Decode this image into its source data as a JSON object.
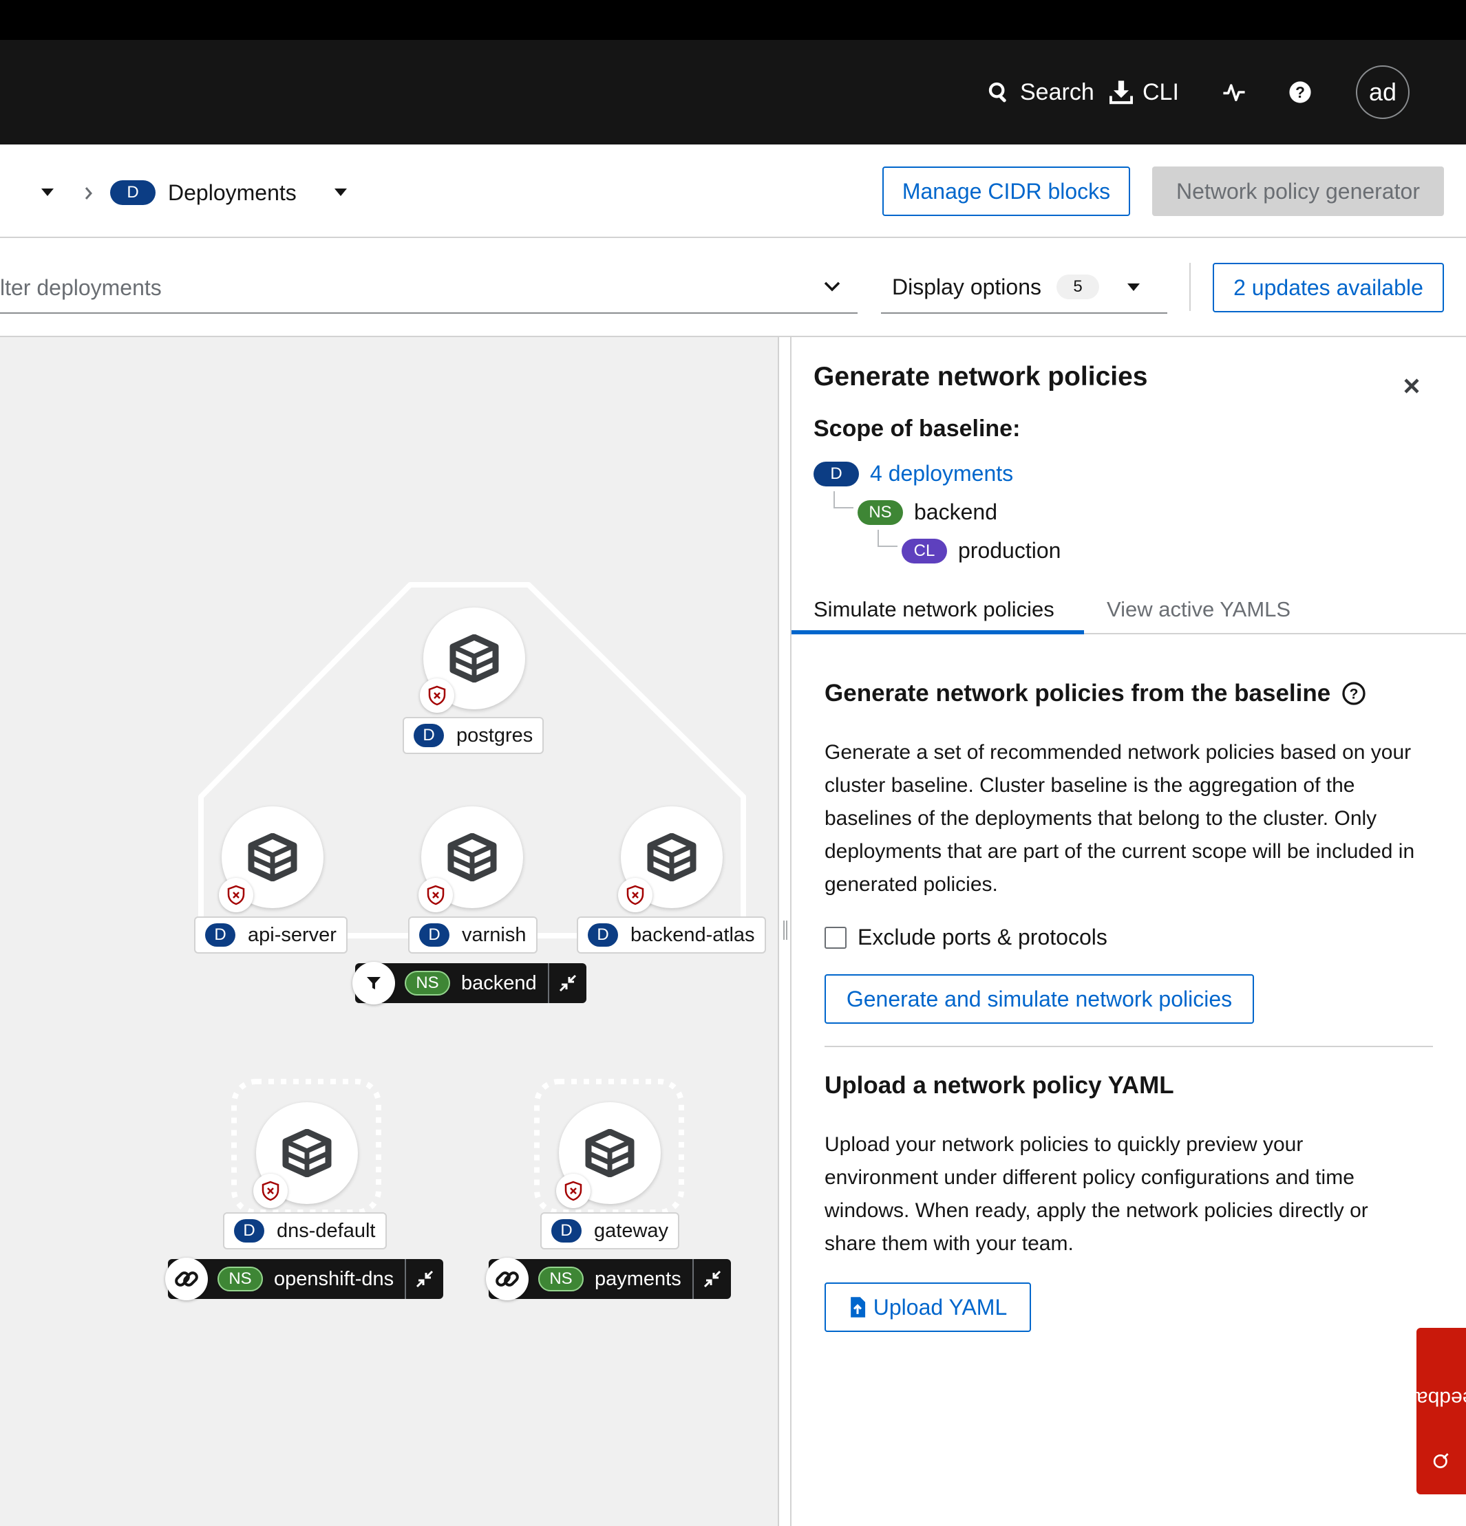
{
  "masthead": {
    "search_label": "Search",
    "cli_label": "CLI",
    "avatar_initials": "ad"
  },
  "toolbar": {
    "entity_badge": "D",
    "entity_label": "Deployments",
    "manage_cidr_label": "Manage CIDR blocks",
    "policy_generator_label": "Network policy generator"
  },
  "filter": {
    "placeholder_visible": "lter deployments",
    "display_options_label": "Display options",
    "display_options_count": "5",
    "updates_label": "2 updates available"
  },
  "graph": {
    "nodes": [
      {
        "badge": "D",
        "name": "postgres"
      },
      {
        "badge": "D",
        "name": "api-server"
      },
      {
        "badge": "D",
        "name": "varnish"
      },
      {
        "badge": "D",
        "name": "backend-atlas"
      },
      {
        "badge": "D",
        "name": "dns-default"
      },
      {
        "badge": "D",
        "name": "gateway"
      }
    ],
    "groups": [
      {
        "badge": "NS",
        "name": "backend"
      },
      {
        "badge": "NS",
        "name": "openshift-dns"
      },
      {
        "badge": "NS",
        "name": "payments"
      }
    ]
  },
  "panel": {
    "title": "Generate network policies",
    "scope_heading": "Scope of baseline:",
    "scope": {
      "deployments_badge": "D",
      "deployments_link": "4 deployments",
      "namespace_badge": "NS",
      "namespace": "backend",
      "cluster_badge": "CL",
      "cluster": "production"
    },
    "tabs": [
      {
        "label": "Simulate network policies",
        "active": true
      },
      {
        "label": "View active YAMLS",
        "active": false
      }
    ],
    "generate_heading": "Generate network policies from the baseline",
    "generate_text": "Generate a set of recommended network policies based on your cluster baseline. Cluster baseline is the aggregation of the baselines of the deployments that belong to the cluster. Only deployments that are part of the current scope will be included in generated policies.",
    "exclude_checkbox_label": "Exclude ports & protocols",
    "exclude_checked": false,
    "generate_button": "Generate and simulate network policies",
    "upload_heading": "Upload a network policy YAML",
    "upload_text": "Upload your network policies to quickly preview your environment under different policy configurations and time windows. When ready, apply the network policies directly or share them with your team.",
    "upload_button": "Upload YAML"
  },
  "feedback_label": "Feedback",
  "colors": {
    "accent": "#0066cc",
    "deployment_badge": "#0c3d84",
    "namespace_badge": "#3e8635",
    "cluster_badge": "#5e40be",
    "feedback": "#c9190b",
    "masthead": "#151515"
  }
}
